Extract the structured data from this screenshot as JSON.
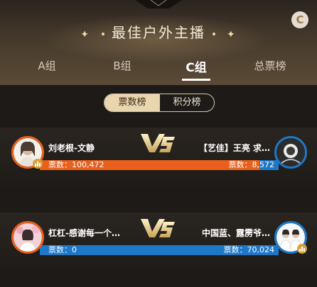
{
  "header": {
    "title": "最佳户外主播",
    "corner_button": "C"
  },
  "tabs": [
    {
      "label": "A组"
    },
    {
      "label": "B组"
    },
    {
      "label": "C组",
      "active": true
    },
    {
      "label": "总票榜"
    }
  ],
  "segment": {
    "options": [
      "票数榜",
      "积分榜"
    ],
    "selected": "票数榜"
  },
  "matches": [
    {
      "left": {
        "name": "刘老根-文静",
        "votes": "票数：100,472"
      },
      "right": {
        "name": "【艺佳】王亮 求…",
        "votes": "票数：8,572"
      },
      "bar_color": "#e8601c",
      "left_share": 0.92
    },
    {
      "left": {
        "name": "杠杠-感谢每一个…",
        "votes": "票数：0"
      },
      "right": {
        "name": "中国蓝、露雳爷…",
        "votes": "票数：70,024"
      },
      "bar_color": "#1e78c8",
      "left_share": 0.0
    }
  ],
  "colors": {
    "accent_gold": "#e9d6ae",
    "orange": "#e8601c",
    "blue": "#1e78c8",
    "badge_gold": "#d8a23a"
  }
}
